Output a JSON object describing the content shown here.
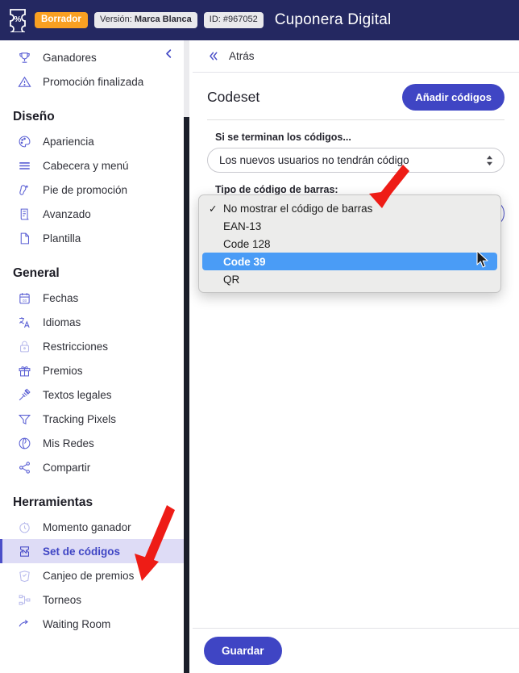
{
  "topbar": {
    "logo_icon": "coupon-percent-icon",
    "status_badge": "Borrador",
    "version_prefix": "Versión: ",
    "version_value": "Marca Blanca",
    "id_label": "ID: #967052",
    "title": "Cuponera Digital",
    "brand_bg": "#242861",
    "draft_bg": "#f9a022"
  },
  "sidebar": {
    "collapse_icon": "chevron-left-icon",
    "groups": [
      {
        "title": null,
        "items": [
          {
            "label": "Ganadores",
            "icon": "trophy-icon",
            "active": false,
            "muted": false
          },
          {
            "label": "Promoción finalizada",
            "icon": "warning-triangle-icon",
            "active": false,
            "muted": false
          }
        ]
      },
      {
        "title": "Diseño",
        "items": [
          {
            "label": "Apariencia",
            "icon": "palette-icon",
            "active": false,
            "muted": false
          },
          {
            "label": "Cabecera y menú",
            "icon": "menu-lines-icon",
            "active": false,
            "muted": false
          },
          {
            "label": "Pie de promoción",
            "icon": "footer-icon",
            "active": false,
            "muted": false
          },
          {
            "label": "Avanzado",
            "icon": "scroll-document-icon",
            "active": false,
            "muted": false
          },
          {
            "label": "Plantilla",
            "icon": "page-icon",
            "active": false,
            "muted": false
          }
        ]
      },
      {
        "title": "General",
        "items": [
          {
            "label": "Fechas",
            "icon": "calendar-icon",
            "active": false,
            "muted": false
          },
          {
            "label": "Idiomas",
            "icon": "translate-icon",
            "active": false,
            "muted": false
          },
          {
            "label": "Restricciones",
            "icon": "lock-icon",
            "active": false,
            "muted": true
          },
          {
            "label": "Premios",
            "icon": "gift-icon",
            "active": false,
            "muted": false
          },
          {
            "label": "Textos legales",
            "icon": "gavel-icon",
            "active": false,
            "muted": false
          },
          {
            "label": "Tracking Pixels",
            "icon": "funnel-icon",
            "active": false,
            "muted": false
          },
          {
            "label": "Mis Redes",
            "icon": "network-globe-icon",
            "active": false,
            "muted": false
          },
          {
            "label": "Compartir",
            "icon": "share-icon",
            "active": false,
            "muted": false
          }
        ]
      },
      {
        "title": "Herramientas",
        "items": [
          {
            "label": "Momento ganador",
            "icon": "stopwatch-icon",
            "active": false,
            "muted": true
          },
          {
            "label": "Set de códigos",
            "icon": "coupon-icon",
            "active": true,
            "muted": false
          },
          {
            "label": "Canjeo de premios",
            "icon": "redeem-icon",
            "active": false,
            "muted": true
          },
          {
            "label": "Torneos",
            "icon": "bracket-icon",
            "active": false,
            "muted": true
          },
          {
            "label": "Waiting Room",
            "icon": "waiting-room-icon",
            "active": false,
            "muted": false
          }
        ]
      }
    ]
  },
  "main": {
    "back_icon": "double-chevron-left-icon",
    "back_label": "Atrás",
    "panel_title": "Codeset",
    "add_codes_button": "Añadir códigos",
    "fields": [
      {
        "label": "Si se terminan los códigos...",
        "value": "Los nuevos usuarios no tendrán código",
        "control": "select",
        "icon": "stepper-updown-icon"
      },
      {
        "label": "Tipo de código de barras:",
        "value": "",
        "control": "select-open"
      }
    ],
    "dropdown": {
      "checked_index": 0,
      "highlighted_index": 3,
      "check_glyph": "✓",
      "options": [
        "No mostrar el código de barras",
        "EAN-13",
        "Code 128",
        "Code 39",
        "QR"
      ],
      "highlight_color": "#4a9cf6"
    },
    "save_button": "Guardar"
  },
  "annotations": {
    "arrow_color": "#ee1c16",
    "arrows": [
      {
        "name": "arrow-to-barcode-select"
      },
      {
        "name": "arrow-to-codeset-menu-item"
      }
    ],
    "cursor": "mouse-pointer"
  }
}
